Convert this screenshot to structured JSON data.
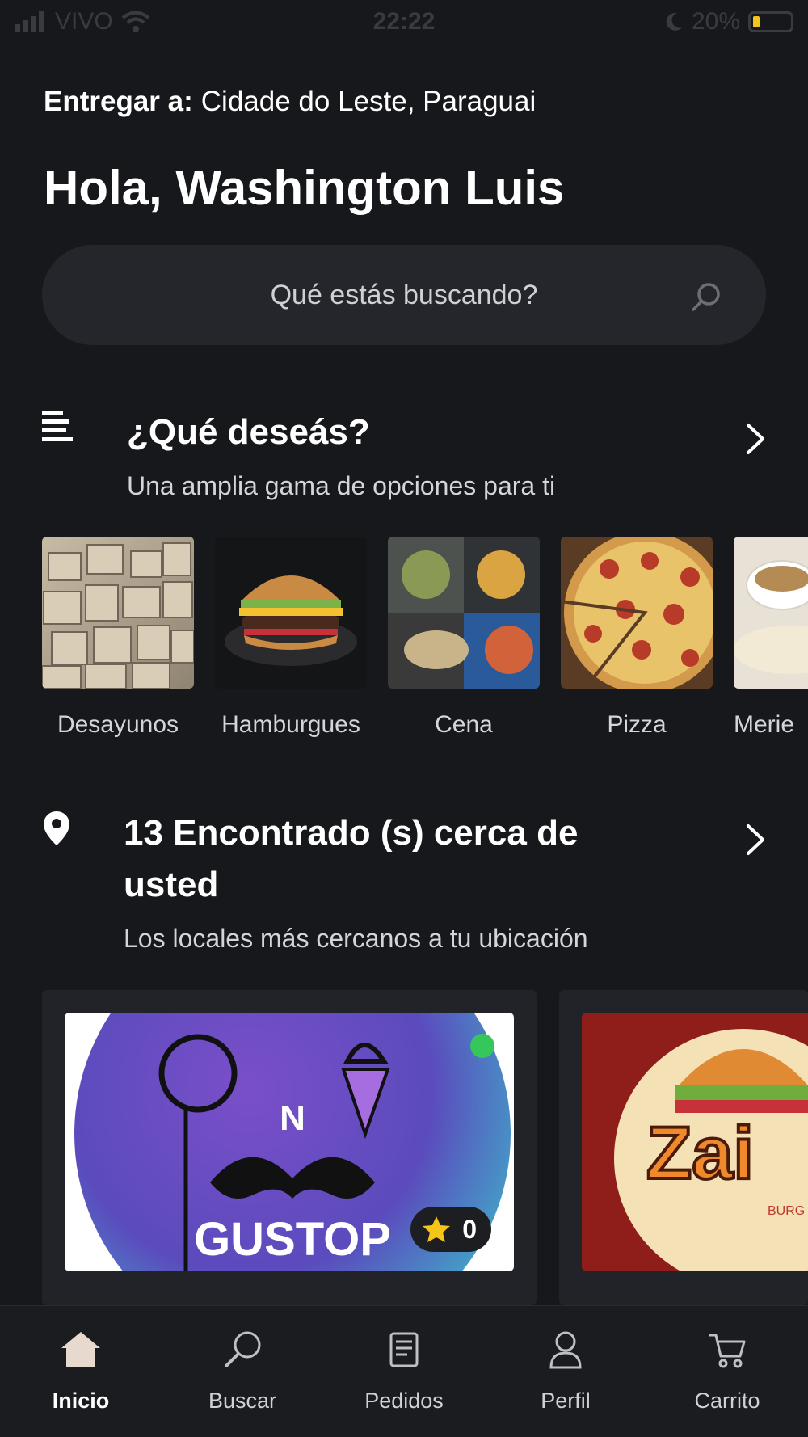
{
  "status_bar": {
    "carrier": "VIVO",
    "time": "22:22",
    "battery": "20%"
  },
  "header": {
    "deliver_label": "Entregar a:",
    "deliver_location": "Cidade do Leste, Paraguai",
    "greeting": "Hola, Washington Luis"
  },
  "search": {
    "placeholder": "Qué estás buscando?"
  },
  "categories_section": {
    "title": "¿Qué deseás?",
    "subtitle": "Una amplia gama de opciones para ti",
    "items": [
      {
        "label": "Desayunos"
      },
      {
        "label": "Hamburgues"
      },
      {
        "label": "Cena"
      },
      {
        "label": "Pizza"
      },
      {
        "label": "Merie"
      }
    ]
  },
  "nearby_section": {
    "title_line1": "13 Encontrado (s) cerca de",
    "title_line2": "usted",
    "subtitle": "Los locales más cercanos a tu ubicación",
    "stores": [
      {
        "logo_text": "GUSTOP",
        "rating": "0"
      },
      {
        "logo_text": "Zai",
        "logo_sub": "BURG & PIZ"
      }
    ]
  },
  "bottom_nav": {
    "items": [
      {
        "label": "Inicio",
        "icon": "home-icon",
        "active": true
      },
      {
        "label": "Buscar",
        "icon": "search-icon"
      },
      {
        "label": "Pedidos",
        "icon": "receipt-icon"
      },
      {
        "label": "Perfil",
        "icon": "user-icon"
      },
      {
        "label": "Carrito",
        "icon": "cart-icon"
      }
    ]
  },
  "colors": {
    "background": "#17181c",
    "surface": "#25262b",
    "online": "#35c759",
    "star": "#f5c518"
  }
}
